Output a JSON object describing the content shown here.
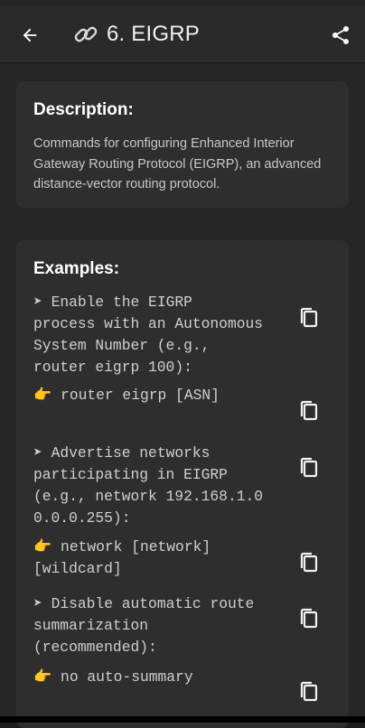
{
  "app": {
    "title": "6. EIGRP",
    "icons": {
      "back": "arrow-left-icon",
      "title": "link-icon",
      "share": "share-icon"
    }
  },
  "description": {
    "heading": "Description:",
    "text": "Commands for configuring Enhanced Interior Gateway Routing Protocol (EIGRP), an advanced distance-vector routing protocol."
  },
  "examples": {
    "heading": "Examples:",
    "items": [
      {
        "desc_lines": [
          "➤ Enable the EIGRP",
          "process with an Autonomous",
          "System Number (e.g.,",
          "router eigrp 100):"
        ],
        "cmd_lines": [
          "👉 router eigrp [ASN]"
        ]
      },
      {
        "desc_lines": [
          "➤ Advertise networks",
          "participating in EIGRP",
          "(e.g., network 192.168.1.0",
          "0.0.0.255):"
        ],
        "cmd_lines": [
          "👉 network [network]",
          "[wildcard]"
        ]
      },
      {
        "desc_lines": [
          "➤ Disable automatic route",
          "summarization",
          "(recommended):"
        ],
        "cmd_lines": [
          "👉 no auto-summary"
        ]
      }
    ]
  },
  "colors": {
    "background": "#262626",
    "card": "#2e2e2e",
    "appbar": "#2a2a2a"
  }
}
